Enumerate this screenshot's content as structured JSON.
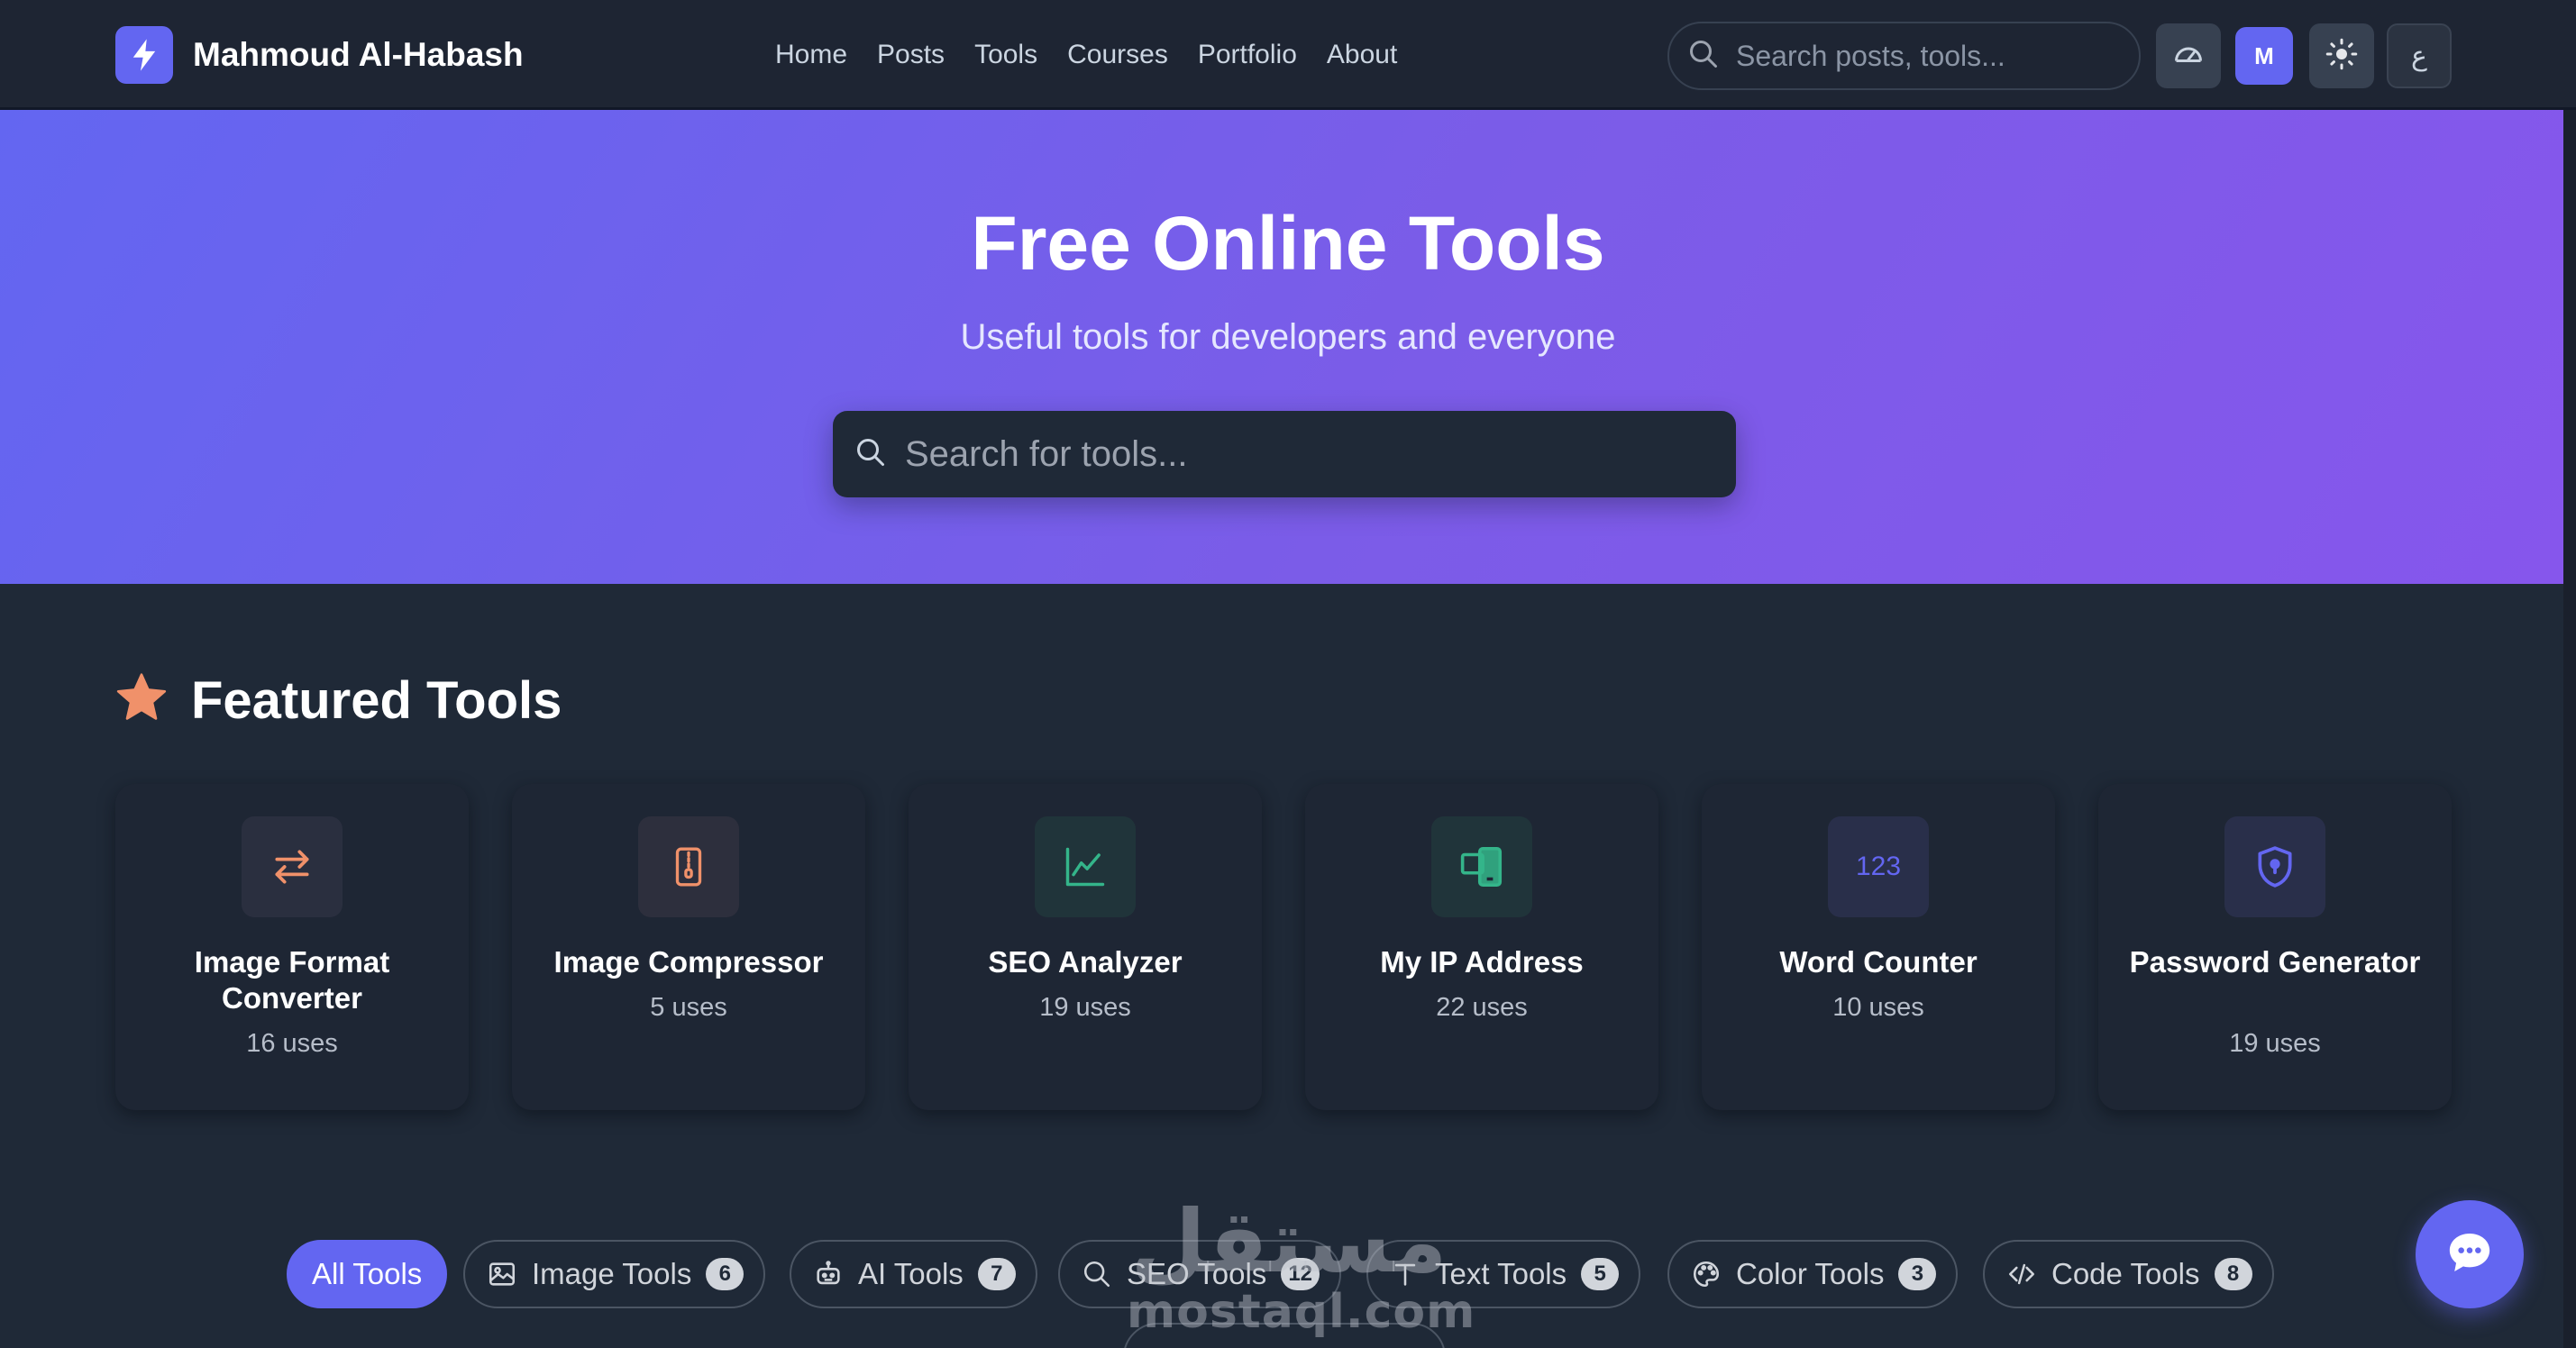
{
  "header": {
    "brand_name": "Mahmoud Al-Habash",
    "nav": [
      "Home",
      "Posts",
      "Tools",
      "Courses",
      "Portfolio",
      "About"
    ],
    "search_placeholder": "Search posts, tools...",
    "avatar_initial": "M",
    "lang_label": "ع"
  },
  "hero": {
    "title": "Free Online Tools",
    "subtitle": "Useful tools for developers and everyone",
    "search_placeholder": "Search for tools..."
  },
  "featured": {
    "title": "Featured Tools",
    "tools": [
      {
        "name": "Image Format Converter",
        "uses": "16 uses",
        "icon": "swap-arrows-icon",
        "icon_color": "#f0916a",
        "tile_color": "#2a2f3f"
      },
      {
        "name": "Image Compressor",
        "uses": "5 uses",
        "icon": "zip-file-icon",
        "icon_color": "#f0916a",
        "tile_color": "#2d2f3d"
      },
      {
        "name": "SEO Analyzer",
        "uses": "19 uses",
        "icon": "chart-line-icon",
        "icon_color": "#34b58a",
        "tile_color": "#20343a"
      },
      {
        "name": "My IP Address",
        "uses": "22 uses",
        "icon": "devices-icon",
        "icon_color": "#34b58a",
        "tile_color": "#20343a"
      },
      {
        "name": "Word Counter",
        "uses": "10 uses",
        "icon": "numbers-icon",
        "icon_label": "123",
        "icon_color": "#6366f1",
        "tile_color": "#292f4a"
      },
      {
        "name": "Password Generator",
        "uses": "19 uses",
        "icon": "shield-lock-icon",
        "icon_color": "#6366f1",
        "tile_color": "#292f4a"
      }
    ]
  },
  "filters": [
    {
      "label": "All Tools",
      "count": null,
      "active": true
    },
    {
      "label": "Image Tools",
      "count": "6",
      "icon": "image-icon"
    },
    {
      "label": "AI Tools",
      "count": "7",
      "icon": "robot-icon"
    },
    {
      "label": "SEO Tools",
      "count": "12",
      "icon": "search-icon"
    },
    {
      "label": "Text Tools",
      "count": "5",
      "icon": "text-icon"
    },
    {
      "label": "Color Tools",
      "count": "3",
      "icon": "palette-icon"
    },
    {
      "label": "Code Tools",
      "count": "8",
      "icon": "code-icon"
    }
  ],
  "watermark": {
    "arabic": "مستقل",
    "latin": "mostaql.com"
  },
  "colors": {
    "accent": "#6366f1",
    "background": "#1f2937",
    "navbar": "#1e2533",
    "star": "#f0916a"
  }
}
